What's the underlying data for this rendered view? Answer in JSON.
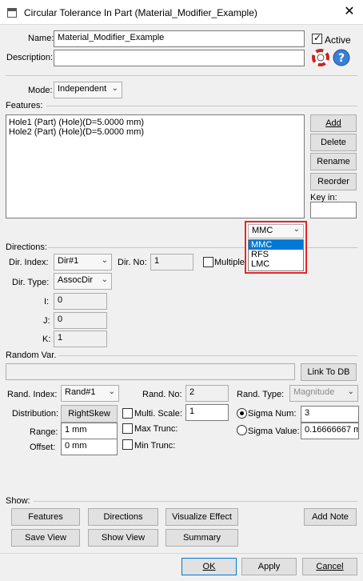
{
  "window": {
    "title": "Circular Tolerance In Part (Material_Modifier_Example)",
    "close_symbol": "✕"
  },
  "header": {
    "name_label": "Name:",
    "name_value": "Material_Modifier_Example",
    "active_label": "Active",
    "active_checked": true,
    "description_label": "Description:",
    "description_value": ""
  },
  "mode": {
    "label": "Mode:",
    "value": "Independent"
  },
  "features": {
    "section_label": "Features:",
    "items": [
      "Hole1 (Part) (Hole)(D=5.0000 mm)",
      "Hole2 (Part) (Hole)(D=5.0000 mm)"
    ],
    "buttons": {
      "add": "Add",
      "delete": "Delete",
      "rename": "Rename",
      "reorder": "Reorder"
    },
    "key_in_label": "Key in:",
    "key_in_value": ""
  },
  "material_dropdown": {
    "selected": "MMC",
    "options": [
      "MMC",
      "RFS",
      "LMC"
    ],
    "highlighted_index": 0
  },
  "directions": {
    "section_label": "Directions:",
    "dir_index_label": "Dir. Index:",
    "dir_index_value": "Dir#1",
    "dir_no_label": "Dir. No:",
    "dir_no_value": "1",
    "multiple_label": "Multiple D",
    "dir_type_label": "Dir. Type:",
    "dir_type_value": "AssocDir",
    "i_label": "I:",
    "i_value": "0",
    "j_label": "J:",
    "j_value": "0",
    "k_label": "K:",
    "k_value": "1"
  },
  "random_var": {
    "section_label": "Random Var.",
    "link_value": "",
    "link_button": "Link To DB",
    "rand_index_label": "Rand. Index:",
    "rand_index_value": "Rand#1",
    "rand_no_label": "Rand. No:",
    "rand_no_value": "2",
    "rand_type_label": "Rand. Type:",
    "rand_type_value": "Magnitude",
    "distribution_label": "Distribution:",
    "distribution_button": "RightSkew",
    "multi_scale_label": "Multi. Scale:",
    "multi_scale_value": "1",
    "sigma_num_label": "Sigma Num:",
    "sigma_num_value": "3",
    "range_label": "Range:",
    "range_value": "1 mm",
    "max_trunc_label": "Max Trunc:",
    "sigma_value_label": "Sigma Value:",
    "sigma_value_value": "0.16666667 m",
    "offset_label": "Offset:",
    "offset_value": "0 mm",
    "min_trunc_label": "Min Trunc:"
  },
  "show": {
    "section_label": "Show:",
    "features_btn": "Features",
    "directions_btn": "Directions",
    "visualize_btn": "Visualize Effect",
    "add_note_btn": "Add Note",
    "save_view_btn": "Save View",
    "show_view_btn": "Show View",
    "summary_btn": "Summary"
  },
  "footer": {
    "ok": "OK",
    "apply": "Apply",
    "cancel": "Cancel"
  },
  "colors": {
    "highlight": "#0078d7",
    "callout_border": "#e0252b",
    "help_icon": "#3a7fd5"
  },
  "icons": [
    "app-window-icon",
    "close-icon",
    "lifebuoy-icon",
    "help-icon",
    "chevron-down-icon"
  ]
}
